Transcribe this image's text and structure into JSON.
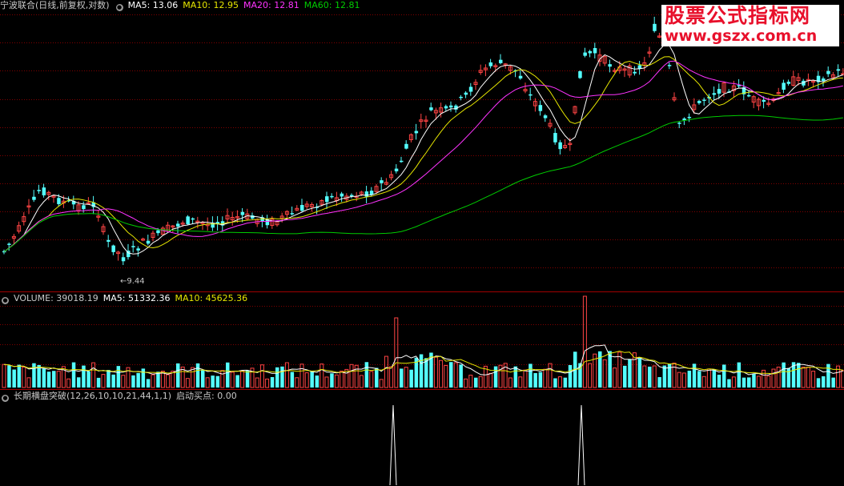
{
  "price_panel": {
    "title": "宁波联合(日线,前复权,对数)",
    "ma5": "MA5: 13.06",
    "ma10": "MA10: 12.95",
    "ma20": "MA20: 12.81",
    "ma60": "MA60: 12.81",
    "low_marker": "9.44"
  },
  "volume_panel": {
    "title": "VOLUME: 39018.19",
    "ma5": "MA5: 51332.36",
    "ma10": "MA10: 45625.36"
  },
  "indicator_panel": {
    "title": "长期横盘突破(12,26,10,10,21,44,1,1)",
    "signal": "启动买点: 0.00"
  },
  "watermark": {
    "title": "股票公式指标网",
    "url": "www.gszx.com.cn"
  },
  "colors": {
    "up": "#ff4444",
    "down": "#54ffff",
    "ma5": "#ffffff",
    "ma10": "#e6e600",
    "ma20": "#ff33ff",
    "ma60": "#00cc00",
    "grid": "#800000"
  }
}
